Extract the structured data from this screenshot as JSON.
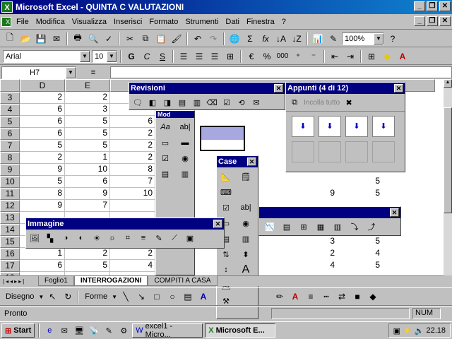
{
  "window": {
    "title": "Microsoft Excel - QUINTA C VALUTAZIONI",
    "app_icon": "excel-icon"
  },
  "menu": [
    "File",
    "Modifica",
    "Visualizza",
    "Inserisci",
    "Formato",
    "Strumenti",
    "Dati",
    "Finestra",
    "?"
  ],
  "standard_toolbar": {
    "zoom": "100%"
  },
  "format_toolbar": {
    "font": "Arial",
    "size": "10",
    "bold": "G",
    "italic": "C",
    "underline": "S",
    "currency": "€",
    "percent": "%",
    "thousands": "000"
  },
  "formula_bar": {
    "name_box": "H7",
    "equals": "="
  },
  "columns": [
    "D",
    "E"
  ],
  "rows": [
    {
      "n": "3",
      "d": "2",
      "e": "2",
      "f": ""
    },
    {
      "n": "4",
      "d": "6",
      "e": "3",
      "f": ""
    },
    {
      "n": "5",
      "d": "6",
      "e": "5",
      "f": "6"
    },
    {
      "n": "6",
      "d": "6",
      "e": "5",
      "f": "2"
    },
    {
      "n": "7",
      "d": "5",
      "e": "5",
      "f": "2"
    },
    {
      "n": "8",
      "d": "2",
      "e": "1",
      "f": "2"
    },
    {
      "n": "9",
      "d": "9",
      "e": "10",
      "f": "8"
    },
    {
      "n": "10",
      "d": "5",
      "e": "6",
      "f": "7"
    },
    {
      "n": "11",
      "d": "8",
      "e": "9",
      "f": "10"
    },
    {
      "n": "12",
      "d": "9",
      "e": "7",
      "f": ""
    },
    {
      "n": "13",
      "d": "",
      "e": "",
      "f": ""
    },
    {
      "n": "14",
      "d": "",
      "e": "",
      "f": ""
    },
    {
      "n": "15",
      "d": "",
      "e": "",
      "f": ""
    },
    {
      "n": "16",
      "d": "1",
      "e": "2",
      "f": "2"
    },
    {
      "n": "17",
      "d": "6",
      "e": "5",
      "f": "4"
    },
    {
      "n": "18",
      "d": "",
      "e": "",
      "f": ""
    }
  ],
  "right_values": [
    {
      "row": "11",
      "a": "9",
      "b": "5"
    },
    {
      "row": "10",
      "a": "",
      "b": "5"
    },
    {
      "row": "15",
      "a": "3",
      "b": "5"
    },
    {
      "row": "16",
      "a": "2",
      "b": "4"
    },
    {
      "row": "17",
      "a": "4",
      "b": "5"
    }
  ],
  "sheet_tabs": [
    "Foglio1",
    "INTERROGAZIONI",
    "COMPITI A CASA"
  ],
  "revisioni": {
    "title": "Revisioni"
  },
  "appunti": {
    "title": "Appunti (4 di 12)",
    "paste_all": "Incolla tutto"
  },
  "immagine": {
    "title": "Immagine"
  },
  "casella": {
    "title": "Case"
  },
  "moduli": {
    "title": "Mod"
  },
  "drawing_toolbar": {
    "draw": "Disegno",
    "shapes": "Forme"
  },
  "status": {
    "ready": "Pronto",
    "num": "NUM"
  },
  "taskbar": {
    "start": "Start",
    "item1": "excel1 - Micro...",
    "item2": "Microsoft E...",
    "clock": "22.18"
  }
}
